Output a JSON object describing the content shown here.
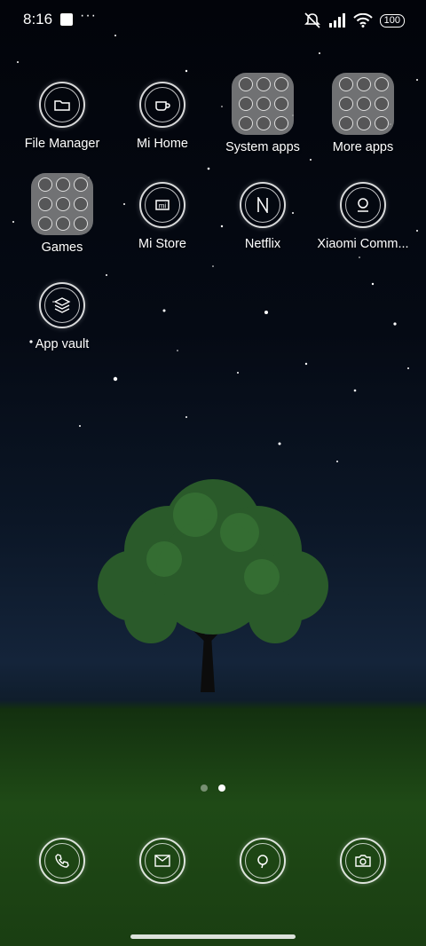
{
  "status_bar": {
    "time": "8:16",
    "battery": "100"
  },
  "apps": [
    {
      "label": "File Manager",
      "icon": "folder-manager-icon"
    },
    {
      "label": "Mi Home",
      "icon": "cup-icon"
    },
    {
      "label": "System apps",
      "icon": "folder-icon"
    },
    {
      "label": "More apps",
      "icon": "folder-icon"
    },
    {
      "label": "Games",
      "icon": "folder-icon"
    },
    {
      "label": "Mi Store",
      "icon": "store-icon"
    },
    {
      "label": "Netflix",
      "icon": "netflix-icon"
    },
    {
      "label": "Xiaomi Comm...",
      "icon": "community-icon"
    },
    {
      "label": "App vault",
      "icon": "layers-icon"
    }
  ],
  "dock": [
    {
      "icon": "phone-icon"
    },
    {
      "icon": "messages-icon"
    },
    {
      "icon": "browser-icon"
    },
    {
      "icon": "camera-icon"
    }
  ],
  "pager": {
    "pages": 2,
    "active": 2
  }
}
